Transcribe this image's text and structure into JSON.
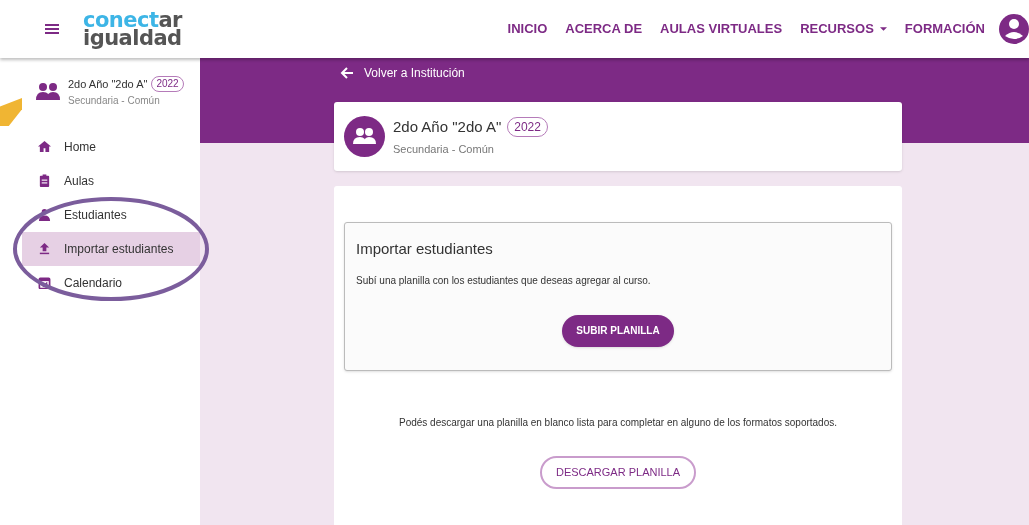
{
  "header": {
    "logo": {
      "line1_accent": "conect",
      "line1_rest": "ar",
      "line2": "igualdad"
    },
    "nav": [
      {
        "label": "INICIO",
        "dropdown": false
      },
      {
        "label": "ACERCA DE",
        "dropdown": false
      },
      {
        "label": "AULAS VIRTUALES",
        "dropdown": false
      },
      {
        "label": "RECURSOS",
        "dropdown": true
      },
      {
        "label": "FORMACIÓN",
        "dropdown": false
      }
    ]
  },
  "sidebar": {
    "course": {
      "title": "2do Año \"2do A\"",
      "year": "2022",
      "subtitle": "Secundaria - Común"
    },
    "items": [
      {
        "label": "Home",
        "selected": false
      },
      {
        "label": "Aulas",
        "selected": false
      },
      {
        "label": "Estudiantes",
        "selected": false
      },
      {
        "label": "Importar estudiantes",
        "selected": true
      },
      {
        "label": "Calendario",
        "selected": false
      }
    ]
  },
  "back_link": "Volver a Institución",
  "course_card": {
    "title": "2do Año \"2do A\"",
    "year": "2022",
    "subtitle": "Secundaria - Común"
  },
  "import_panel": {
    "title": "Importar estudiantes",
    "text": "Subí una planilla con los estudiantes que deseas agregar al curso.",
    "button": "SUBIR PLANILLA"
  },
  "download": {
    "text": "Podés descargar una planilla en blanco lista para completar en alguno de los formatos soportados.",
    "button": "DESCARGAR PLANILLA"
  }
}
